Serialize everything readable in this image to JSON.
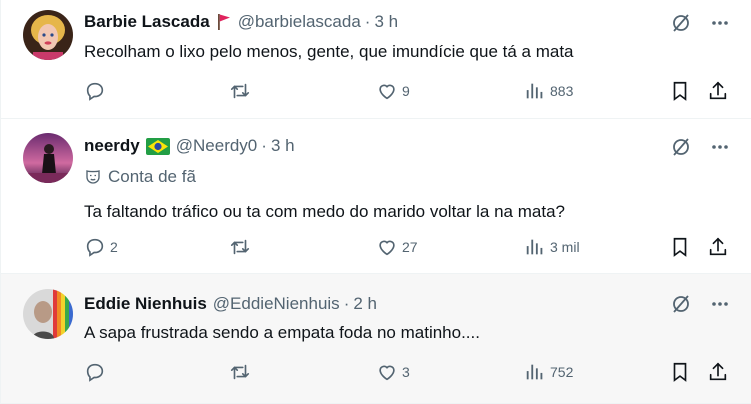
{
  "tweets": [
    {
      "name": "Barbie Lascada",
      "handle": "@barbielascada",
      "time": "3 h",
      "badge_icon": "red-flag-icon",
      "fan_label": "",
      "text": "Recolham o lixo pelo menos, gente, que imundície que tá a mata",
      "replies": "",
      "retweets": "",
      "likes": "9",
      "views": "883"
    },
    {
      "name": "neerdy",
      "handle": "@Neerdy0",
      "time": "3 h",
      "badge_icon": "brazil-flag-icon",
      "fan_label": "Conta de fã",
      "text": "Ta faltando tráfico ou ta com medo do marido voltar la na mata?",
      "replies": "2",
      "retweets": "",
      "likes": "27",
      "views": "3 mil"
    },
    {
      "name": "Eddie Nienhuis",
      "handle": "@EddieNienhuis",
      "time": "2 h",
      "badge_icon": "",
      "fan_label": "",
      "text": "A sapa frustrada sendo a empata foda no matinho....",
      "replies": "",
      "retweets": "",
      "likes": "3",
      "views": "752"
    }
  ],
  "dot": "·",
  "colors": {
    "text": "#0f1419",
    "muted": "#536471",
    "border": "#eff3f4",
    "hover_bg": "#f7f7f7"
  },
  "icons": [
    "reply-icon",
    "retweet-icon",
    "like-icon",
    "views-icon",
    "bookmark-icon",
    "share-icon",
    "grok-icon",
    "more-icon",
    "mask-icon"
  ]
}
